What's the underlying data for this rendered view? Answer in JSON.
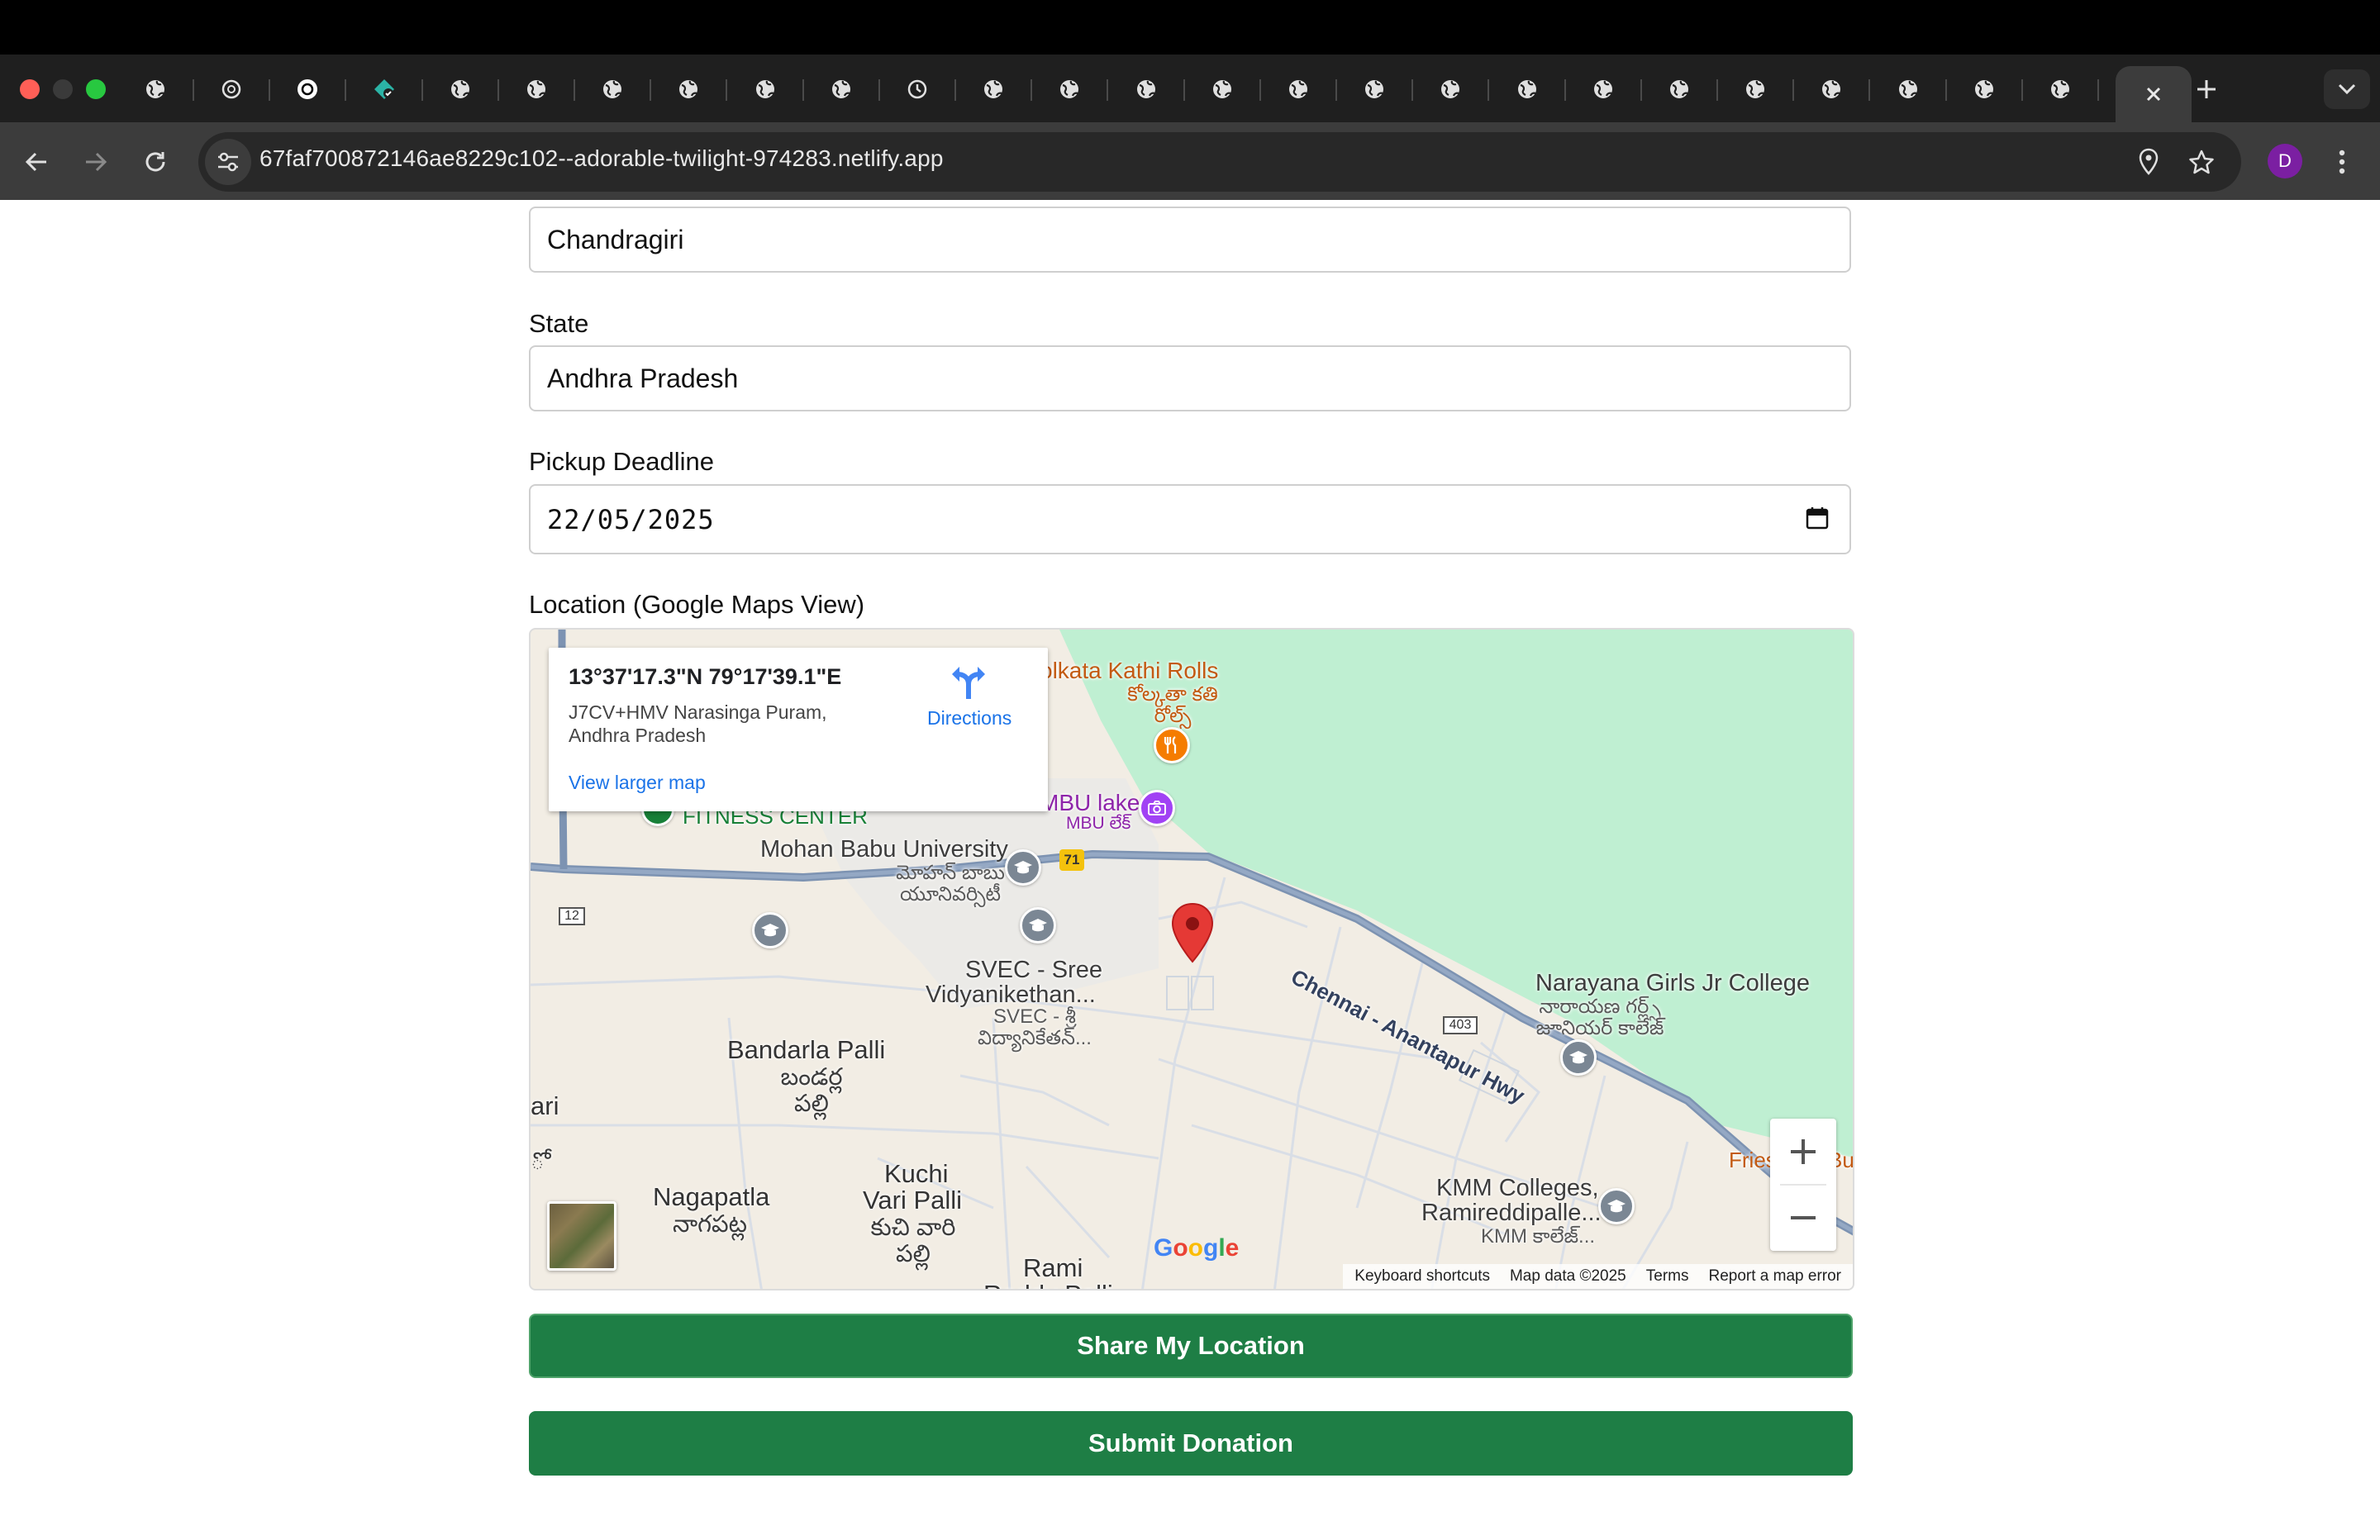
{
  "browser": {
    "url": "67faf700872146ae8229c102--adorable-twilight-974283.netlify.app",
    "profile_initial": "D",
    "tab_count": 27,
    "colors": {
      "close": "#ff5f57",
      "minimize": "#3a3a3a",
      "maximize": "#28c840"
    }
  },
  "form": {
    "city_value": "Chandragiri",
    "state_label": "State",
    "state_value": "Andhra Pradesh",
    "deadline_label": "Pickup Deadline",
    "deadline_value": "22/05/2025",
    "location_label": "Location (Google Maps View)"
  },
  "map": {
    "info": {
      "coords": "13°37'17.3\"N 79°17'39.1\"E",
      "address_line1": "J7CV+HMV Narasinga Puram,",
      "address_line2": "Andhra Pradesh",
      "directions": "Directions",
      "view_larger": "View larger map"
    },
    "labels": {
      "kathi_rolls": "olkata Kathi Rolls",
      "kathi_rolls_te": "కోల్కతా కతి రోల్స్",
      "mbu_lake": "MBU lake",
      "mbu_lake_te": "MBU లేక్",
      "fitness": "FITNESS CENTER",
      "mohan_babu": "Mohan Babu University",
      "mohan_babu_te": "మోహన్ బాబు యూనివర్సిటీ",
      "svec": "SVEC - Sree",
      "svec2": "Vidyanikethan...",
      "svec_te": "SVEC - శ్రీ విద్యానికేతన్...",
      "highway": "Chennai - Anantapur Hwy",
      "narayana": "Narayana Girls Jr College",
      "narayana_te": "నారాయణ గర్ల్స్ జూనియర్ కాలేజ్",
      "bandarla": "Bandarla Palli",
      "bandarla_te": "బండర్ల పల్లి",
      "nagapatla": "Nagapatla",
      "nagapatla_te": "నాగపట్ల",
      "kuchi": "Kuchi",
      "kuchi2": "Vari Palli",
      "kuchi_te": "కుచి వారి పల్లి",
      "rami": "Rami",
      "rami2": "Reddy Palli",
      "kmm": "KMM Colleges,",
      "kmm2": "Ramireddipalle...",
      "kmm_te": "KMM కాలేజ్...",
      "fries": "Fries",
      "bu": "Bu",
      "ari": "ari",
      "ro": "ో",
      "route_71": "71",
      "route_12": "12",
      "route_403": "403"
    },
    "attribution": {
      "shortcuts": "Keyboard shortcuts",
      "data": "Map data ©2025",
      "terms": "Terms",
      "report": "Report a map error"
    },
    "google": "Google",
    "colors": {
      "park": "#bfefd2",
      "land": "#f2ede4",
      "road": "#7d93b2",
      "marker": "#e53935"
    }
  },
  "actions": {
    "share": "Share My Location",
    "submit": "Submit Donation",
    "color": "#1e7e45"
  }
}
